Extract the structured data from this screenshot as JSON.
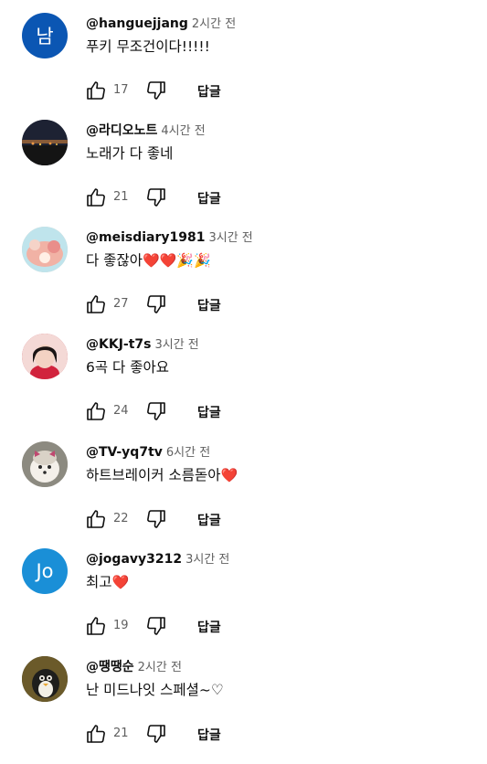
{
  "comments": [
    {
      "author": "@hanguejjang",
      "time": "2시간 전",
      "text": "푸키  무조건이다!!!!!",
      "emoji": "",
      "likes": "17",
      "reply": "답글",
      "avatar": {
        "type": "letter",
        "letter": "남",
        "color": "#0b56b3"
      }
    },
    {
      "author": "@라디오노트",
      "time": "4시간 전",
      "text": "노래가 다 좋네",
      "emoji": "",
      "likes": "21",
      "reply": "답글",
      "avatar": {
        "type": "image",
        "color": "#2b2f3a"
      }
    },
    {
      "author": "@meisdiary1981",
      "time": "3시간 전",
      "text": "다 좋잖아",
      "emoji": "❤️❤️🎉🎉",
      "likes": "27",
      "reply": "답글",
      "avatar": {
        "type": "image",
        "color": "#e9c9b6"
      }
    },
    {
      "author": "@KKJ-t7s",
      "time": "3시간 전",
      "text": "6곡 다 좋아요",
      "emoji": "",
      "likes": "24",
      "reply": "답글",
      "avatar": {
        "type": "image",
        "color": "#c23346"
      }
    },
    {
      "author": "@TV-yq7tv",
      "time": "6시간 전",
      "text": "하트브레이커 소름돋아",
      "emoji": "❤️",
      "likes": "22",
      "reply": "답글",
      "avatar": {
        "type": "image",
        "color": "#b9b2a8"
      }
    },
    {
      "author": "@jogavy3212",
      "time": "3시간 전",
      "text": "최고",
      "emoji": "❤️",
      "likes": "19",
      "reply": "답글",
      "avatar": {
        "type": "letter",
        "letter": "Jo",
        "color": "#1a8fd7"
      }
    },
    {
      "author": "@땡땡순",
      "time": "2시간 전",
      "text": "난 미드나잇 스페셜~♡",
      "emoji": "",
      "likes": "21",
      "reply": "답글",
      "avatar": {
        "type": "image",
        "color": "#3b3d2a"
      }
    }
  ]
}
